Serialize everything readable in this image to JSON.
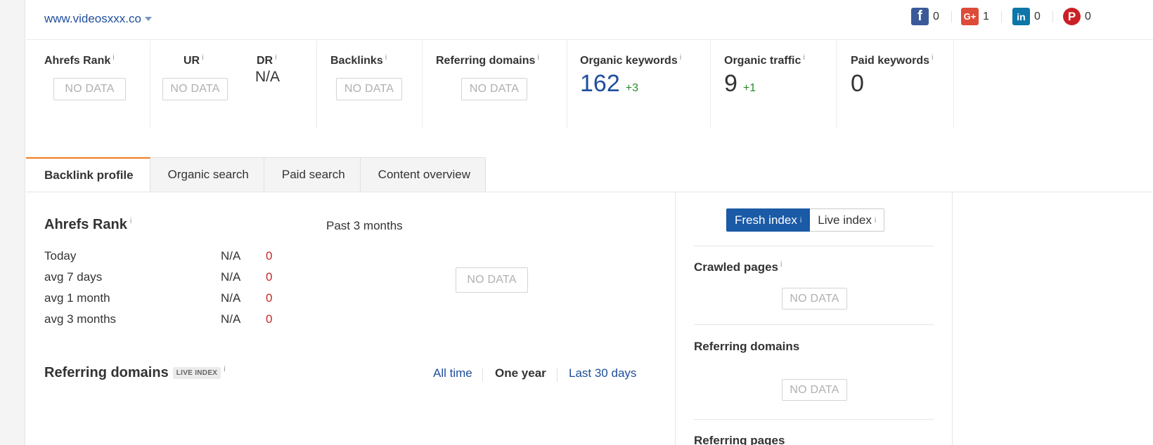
{
  "header": {
    "site": "www.videosxxx.co",
    "social": [
      {
        "name": "facebook",
        "icon": "facebook-icon",
        "glyph": "f",
        "count": "0",
        "color": "#3b5998"
      },
      {
        "name": "google-plus",
        "icon": "google-plus-icon",
        "glyph": "G+",
        "count": "1",
        "color": "#dd4b39"
      },
      {
        "name": "linkedin",
        "icon": "linkedin-icon",
        "glyph": "in",
        "count": "0",
        "color": "#0e76a8"
      },
      {
        "name": "pinterest",
        "icon": "pinterest-icon",
        "glyph": "P",
        "count": "0",
        "color": "#cb2027"
      }
    ]
  },
  "metrics": {
    "ahrefs_rank": {
      "label": "Ahrefs Rank",
      "value": "NO DATA"
    },
    "ur": {
      "label": "UR",
      "value": "NO DATA"
    },
    "dr": {
      "label": "DR",
      "value": "N/A"
    },
    "backlinks": {
      "label": "Backlinks",
      "value": "NO DATA"
    },
    "referring_domains": {
      "label": "Referring domains",
      "value": "NO DATA"
    },
    "organic_keywords": {
      "label": "Organic keywords",
      "value": "162",
      "delta": "+3"
    },
    "organic_traffic": {
      "label": "Organic traffic",
      "value": "9",
      "delta": "+1"
    },
    "paid_keywords": {
      "label": "Paid keywords",
      "value": "0"
    }
  },
  "info_glyph": "i",
  "tabs": [
    "Backlink profile",
    "Organic search",
    "Paid search",
    "Content overview"
  ],
  "rank_section": {
    "title": "Ahrefs Rank",
    "period": "Past 3 months",
    "rows": [
      {
        "label": "Today",
        "value": "N/A",
        "change": "0"
      },
      {
        "label": "avg 7 days",
        "value": "N/A",
        "change": "0"
      },
      {
        "label": "avg 1 month",
        "value": "N/A",
        "change": "0"
      },
      {
        "label": "avg 3 months",
        "value": "N/A",
        "change": "0"
      }
    ],
    "chart_placeholder": "NO DATA"
  },
  "refdomains_section": {
    "title": "Referring domains",
    "badge": "LIVE INDEX",
    "filters": {
      "all_time": "All time",
      "one_year": "One year",
      "last_30_days": "Last 30 days"
    },
    "selected": "One year"
  },
  "sidebar": {
    "index_toggle": {
      "fresh": "Fresh index",
      "live": "Live index",
      "selected": "Fresh index"
    },
    "crawled_pages": {
      "title": "Crawled pages",
      "value": "NO DATA"
    },
    "referring_domains": {
      "title": "Referring domains",
      "value": "NO DATA"
    },
    "referring_pages": {
      "title": "Referring pages"
    }
  },
  "colors": {
    "accent_tab": "#f07a1b",
    "link": "#1f4e9c",
    "positive": "#2b8a2b",
    "negative": "#c62828",
    "toggle_on": "#1a5aa6"
  }
}
